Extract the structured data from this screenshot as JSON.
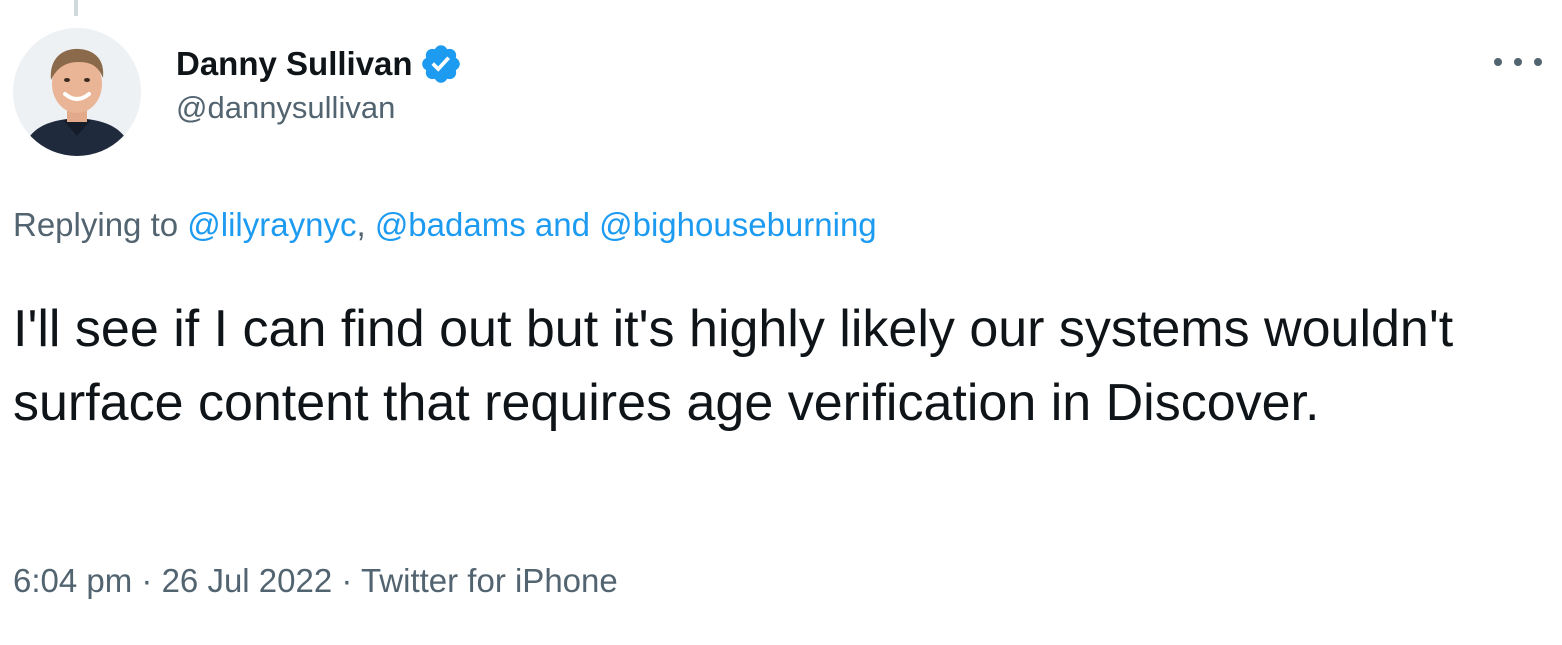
{
  "author": {
    "display_name": "Danny Sullivan",
    "handle": "@dannysullivan",
    "verified": true
  },
  "reply": {
    "prefix": "Replying to ",
    "mentions": [
      "@lilyraynyc",
      "@badams",
      "@bighouseburning"
    ],
    "separator": ", ",
    "conjunction": " and "
  },
  "tweet": {
    "text": "I'll see if I can find out but it's highly likely our systems wouldn't surface content that requires age verification in Discover."
  },
  "meta": {
    "time": "6:04 pm",
    "dot": " · ",
    "date": "26 Jul 2022",
    "source": "Twitter for iPhone"
  },
  "colors": {
    "link": "#1d9bf0",
    "secondary_text": "#536471",
    "primary_text": "#0f1419",
    "verified_badge": "#1d9bf0"
  },
  "icons": {
    "verified": "verified-badge-icon",
    "more": "more-options-icon"
  }
}
